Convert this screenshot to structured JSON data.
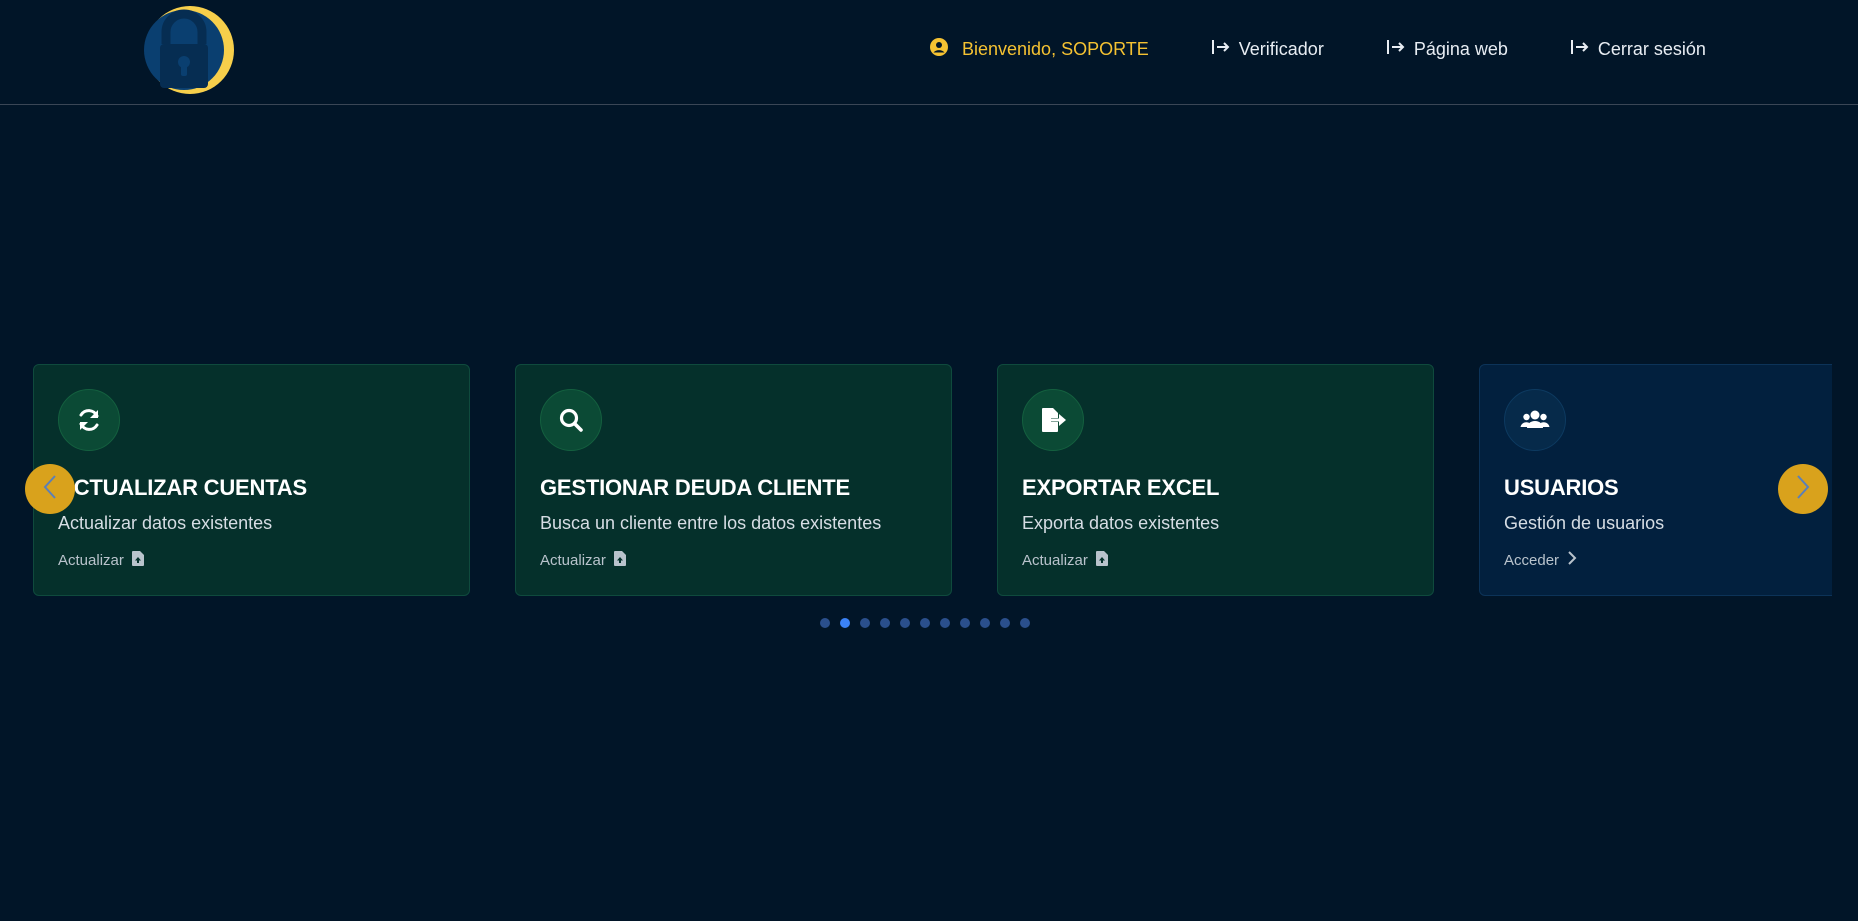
{
  "header": {
    "welcome": "Bienvenido, SOPORTE",
    "links": [
      {
        "label": "Verificador"
      },
      {
        "label": "Página web"
      },
      {
        "label": "Cerrar sesión"
      }
    ]
  },
  "cards": [
    {
      "title": "ACTUALIZAR CUENTAS",
      "description": "Actualizar datos existentes",
      "action": "Actualizar",
      "icon": "sync-icon"
    },
    {
      "title": "GESTIONAR DEUDA CLIENTE",
      "description": "Busca un cliente entre los datos existentes",
      "action": "Actualizar",
      "icon": "search-icon"
    },
    {
      "title": "EXPORTAR EXCEL",
      "description": "Exporta datos existentes",
      "action": "Actualizar",
      "icon": "file-export-icon"
    },
    {
      "title": "USUARIOS",
      "description": "Gestión de usuarios",
      "action": "Acceder",
      "icon": "users-icon"
    }
  ],
  "carousel": {
    "dot_count": 11,
    "active_dot": 1
  },
  "colors": {
    "background": "#011528",
    "accent": "#f5c232",
    "arrow": "#d9a21c",
    "card_green": "#05302b",
    "card_blue": "#02203e",
    "dot": "#2a4f8c",
    "dot_active": "#3b82f6"
  }
}
